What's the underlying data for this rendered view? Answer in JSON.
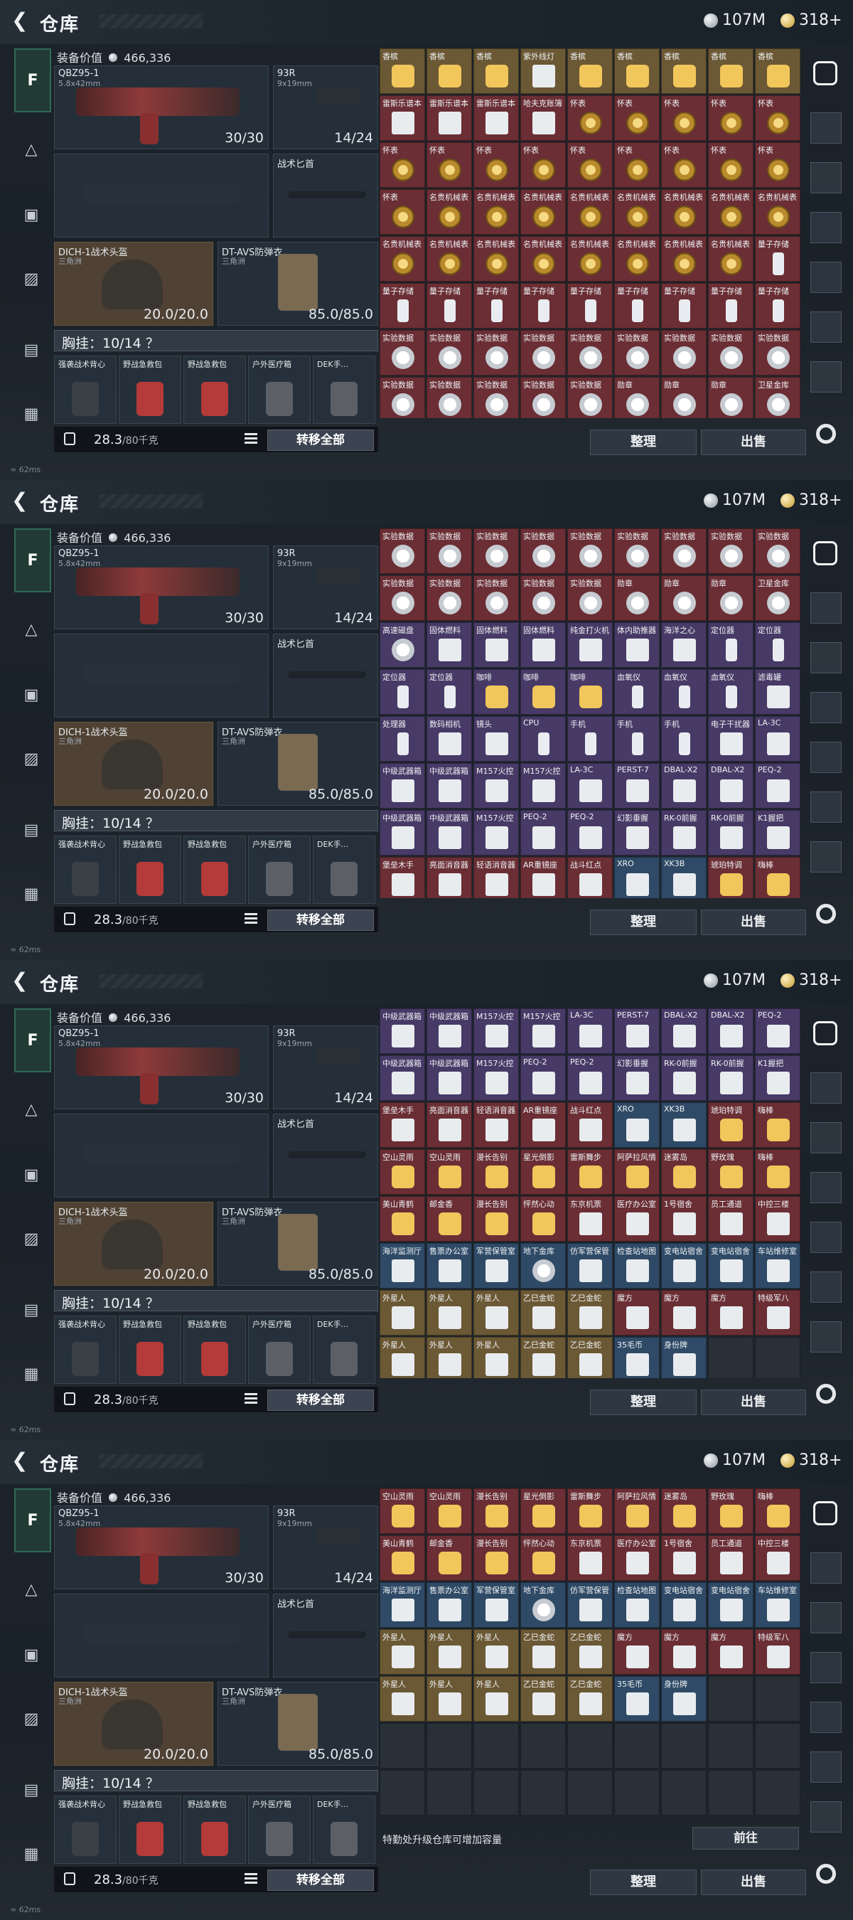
{
  "header": {
    "title": "仓库",
    "back_icon": "back-arrow-icon",
    "silver_amount": "107M",
    "gold_amount": "318+"
  },
  "loadout": {
    "equip_value_label": "装备价值",
    "equip_value": "466,336",
    "primary": {
      "name": "QBZ95-1",
      "caliber": "5.8x42mm",
      "ammo": "30/30"
    },
    "pistol": {
      "name": "93R",
      "caliber": "9x19mm",
      "ammo": "14/24"
    },
    "melee": {
      "name": "战术匕首"
    },
    "helmet": {
      "name": "DICH-1战术头盔",
      "sub": "三角洲",
      "durability": "20.0/20.0"
    },
    "armor": {
      "name": "DT-AVS防弹衣",
      "sub": "三角洲",
      "durability": "85.0/85.0"
    },
    "chest_rig": "胸挂：10/14 ？",
    "rig_items": [
      "强袭战术背心",
      "野战急救包",
      "野战急救包",
      "户外医疗箱",
      "DEK手..."
    ],
    "weight": "28.3",
    "weight_max": "/80千克",
    "transfer_all": "转移全部"
  },
  "actions": {
    "sort": "整理",
    "sell": "出售"
  },
  "upgrade": {
    "text": "特勤处升级仓库可增加容量",
    "go": "前往"
  },
  "status": {
    "ping": "62ms"
  },
  "stash_sections": [
    {
      "rows": [
        [
          "香槟",
          "香槟",
          "香槟",
          "紫外线灯",
          "香槟",
          "香槟",
          "香槟",
          "香槟",
          "香槟"
        ],
        [
          "雷斯乐谱本",
          "雷斯乐谱本",
          "雷斯乐谱本",
          "哈夫克账簿",
          "怀表",
          "怀表",
          "怀表",
          "怀表",
          "怀表"
        ],
        [
          "怀表",
          "怀表",
          "怀表",
          "怀表",
          "怀表",
          "怀表",
          "怀表",
          "怀表",
          "怀表"
        ],
        [
          "怀表",
          "名贵机械表",
          "名贵机械表",
          "名贵机械表",
          "名贵机械表",
          "名贵机械表",
          "名贵机械表",
          "名贵机械表",
          "名贵机械表"
        ],
        [
          "名贵机械表",
          "名贵机械表",
          "名贵机械表",
          "名贵机械表",
          "名贵机械表",
          "名贵机械表",
          "名贵机械表",
          "名贵机械表",
          "量子存储"
        ],
        [
          "量子存储",
          "量子存储",
          "量子存储",
          "量子存储",
          "量子存储",
          "量子存储",
          "量子存储",
          "量子存储",
          "量子存储"
        ],
        [
          "实验数据",
          "实验数据",
          "实验数据",
          "实验数据",
          "实验数据",
          "实验数据",
          "实验数据",
          "实验数据",
          "实验数据"
        ],
        [
          "实验数据",
          "实验数据",
          "实验数据",
          "实验数据",
          "实验数据",
          "勋章",
          "勋章",
          "勋章",
          "卫星金库"
        ]
      ]
    },
    {
      "rows": [
        [
          "实验数据",
          "实验数据",
          "实验数据",
          "实验数据",
          "实验数据",
          "实验数据",
          "实验数据",
          "实验数据",
          "实验数据"
        ],
        [
          "实验数据",
          "实验数据",
          "实验数据",
          "实验数据",
          "实验数据",
          "勋章",
          "勋章",
          "勋章",
          "卫星金库"
        ],
        [
          "高速磁盘",
          "固体燃料",
          "固体燃料",
          "固体燃料",
          "纯金打火机",
          "体内助推器",
          "海洋之心",
          "定位器",
          "定位器"
        ],
        [
          "定位器",
          "定位器",
          "咖啡",
          "咖啡",
          "咖啡",
          "血氧仪",
          "血氧仪",
          "血氧仪",
          "滤毒罐"
        ],
        [
          "处理器",
          "数码相机",
          "镜头",
          "CPU",
          "手机",
          "手机",
          "手机",
          "电子干扰器",
          "LA-3C"
        ],
        [
          "中级武器箱",
          "中级武器箱",
          "M157火控",
          "M157火控",
          "LA-3C",
          "PERST-7",
          "DBAL-X2",
          "DBAL-X2",
          "PEQ-2"
        ],
        [
          "中级武器箱",
          "中级武器箱",
          "M157火控",
          "PEQ-2",
          "PEQ-2",
          "幻影垂握",
          "RK-0前握",
          "RK-0前握",
          "K1握把"
        ],
        [
          "堡垒木手",
          "亮面消音器",
          "轻语消音器",
          "AR重镜座",
          "战斗红点",
          "XRO",
          "XK3B",
          "琥珀特调",
          "嗨棒"
        ]
      ]
    },
    {
      "rows": [
        [
          "中级武器箱",
          "中级武器箱",
          "M157火控",
          "M157火控",
          "LA-3C",
          "PERST-7",
          "DBAL-X2",
          "DBAL-X2",
          "PEQ-2"
        ],
        [
          "中级武器箱",
          "中级武器箱",
          "M157火控",
          "PEQ-2",
          "PEQ-2",
          "幻影垂握",
          "RK-0前握",
          "RK-0前握",
          "K1握把"
        ],
        [
          "堡垒木手",
          "亮面消音器",
          "轻语消音器",
          "AR重镜座",
          "战斗红点",
          "XRO",
          "XK3B",
          "琥珀特调",
          "嗨棒"
        ],
        [
          "空山灵雨",
          "空山灵雨",
          "漫长告别",
          "星光倒影",
          "雷斯舞步",
          "阿萨拉风情",
          "迷雾岛",
          "野玫瑰",
          "嗨棒"
        ],
        [
          "美山青鹤",
          "邮金香",
          "漫长告别",
          "怦然心动",
          "东京机票",
          "医疗办公室",
          "1号宿舍",
          "员工通道",
          "中控三楼"
        ],
        [
          "海洋监测厅",
          "售票办公室",
          "军营保管室",
          "地下金库",
          "仿军营保管",
          "检查站地图",
          "变电站宿舍",
          "变电站宿舍",
          "车站维修室"
        ],
        [
          "外星人",
          "外星人",
          "外星人",
          "乙巳金蛇",
          "乙巳金蛇",
          "魔方",
          "魔方",
          "魔方",
          "特级军八"
        ],
        [
          "外星人",
          "外星人",
          "外星人",
          "乙巳金蛇",
          "乙巳金蛇",
          "35毛币",
          "身份牌",
          "",
          ""
        ]
      ]
    },
    {
      "rows": [
        [
          "空山灵雨",
          "空山灵雨",
          "漫长告别",
          "星光倒影",
          "雷斯舞步",
          "阿萨拉风情",
          "迷雾岛",
          "野玫瑰",
          "嗨棒"
        ],
        [
          "美山青鹤",
          "邮金香",
          "漫长告别",
          "怦然心动",
          "东京机票",
          "医疗办公室",
          "1号宿舍",
          "员工通道",
          "中控三楼"
        ],
        [
          "海洋监测厅",
          "售票办公室",
          "军营保管室",
          "地下金库",
          "仿军营保管",
          "检查站地图",
          "变电站宿舍",
          "变电站宿舍",
          "车站维修室"
        ],
        [
          "外星人",
          "外星人",
          "外星人",
          "乙巳金蛇",
          "乙巳金蛇",
          "魔方",
          "魔方",
          "魔方",
          "特级军八"
        ],
        [
          "外星人",
          "外星人",
          "外星人",
          "乙巳金蛇",
          "乙巳金蛇",
          "35毛币",
          "身份牌",
          "",
          ""
        ],
        [
          "",
          "",
          "",
          "",
          "",
          "",
          "",
          "",
          ""
        ],
        [
          "",
          "",
          "",
          "",
          "",
          "",
          "",
          "",
          ""
        ]
      ]
    }
  ],
  "colors": {
    "accent_green": "#2f6a58",
    "cell_red": "#6a2e34",
    "cell_gold": "#6b5834",
    "cell_purple": "#473a66",
    "cell_blue": "#2f4a66"
  }
}
